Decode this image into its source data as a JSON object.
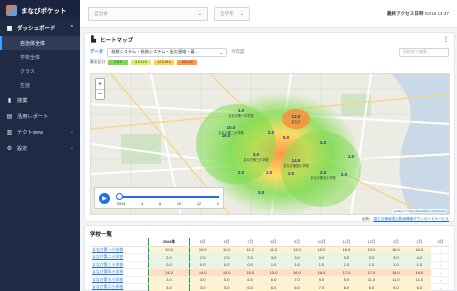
{
  "app": {
    "logo_text": "まなびポケット"
  },
  "sidebar": {
    "group_label": "ダッシュボード",
    "sub_items": [
      {
        "label": "自治体全体",
        "active": true
      },
      {
        "label": "学校全体",
        "active": false
      },
      {
        "label": "クラス",
        "active": false
      },
      {
        "label": "生徒",
        "active": false
      }
    ],
    "items": [
      {
        "label": "授業",
        "icon": "bar-chart-icon"
      },
      {
        "label": "活用レポート",
        "icon": "report-icon"
      },
      {
        "label": "テクトview",
        "icon": "analytics-icon",
        "has_children": true
      },
      {
        "label": "設定",
        "icon": "gear-icon",
        "has_children": true
      }
    ]
  },
  "topbar": {
    "select1_placeholder": "自治体",
    "select2_placeholder": "全学年",
    "last_access_label": "最終アクセス日時",
    "last_access_value": "02/16 14:47"
  },
  "heatmap": {
    "title": "ヒートマップ",
    "filter_label": "データ",
    "filter_value": "校務システム・校務システム・出欠連絡・着...",
    "sub_label": "今年度",
    "search_placeholder": "学校名で検索...",
    "legend_title": "算出区分",
    "legend": [
      {
        "label": "0-5.5",
        "color": "#7ed957"
      },
      {
        "label": "5.5-12.5",
        "color": "#d7ef6a"
      },
      {
        "label": "12.5-18.0",
        "color": "#ffd24d"
      },
      {
        "label": "18.0-22",
        "color": "#ff9a4d"
      }
    ],
    "map_labels": [
      {
        "name": "まなび第一中学校",
        "value": "1.0"
      },
      {
        "name": "まなび第二小学校",
        "value": "10.0"
      },
      {
        "name": "まなび第三小学校",
        "value": "2.0"
      },
      {
        "name": "まなび第四小学校",
        "value": "14.0"
      },
      {
        "name": "まなび第五小学校",
        "value": "3.0"
      },
      {
        "name": "まなび",
        "value": "16.0"
      },
      {
        "name": "まなび",
        "value": "13.0"
      },
      {
        "name": "まなび",
        "value": "5.0"
      }
    ],
    "timeline_ticks": [
      "2024",
      "4",
      "8",
      "10",
      "12",
      "2"
    ],
    "attribution": "Leaflet | © OpenStreetMap contributors",
    "source_label": "出典",
    "source_link": "国土交通省国土数値情報ダウンロードサービス"
  },
  "school_table": {
    "title": "学校一覧",
    "columns": [
      "",
      "2024年",
      "5月",
      "6月",
      "7月",
      "8月",
      "9月",
      "10月",
      "11月",
      "12月",
      "1月",
      "2月",
      "3月"
    ],
    "current_col": 1,
    "rows": [
      {
        "name": "まなび第一小学校",
        "values": [
          "10.0",
          "10.0",
          "11.0",
          "11.0",
          "11.0",
          "13.0",
          "15.0",
          "16.0",
          "15.0",
          "16.0",
          "16.0",
          "-"
        ],
        "level": 1
      },
      {
        "name": "まなび第二小学校",
        "values": [
          "2.0",
          "2.0",
          "2.0",
          "2.0",
          "3.0",
          "3.0",
          "3.0",
          "3.0",
          "3.0",
          "3.0",
          "4.0",
          "-"
        ],
        "level": 0
      },
      {
        "name": "まなび第三小学校",
        "values": [
          "0.0",
          "0.0",
          "0.0",
          "0.0",
          "1.0",
          "1.0",
          "1.0",
          "1.0",
          "1.0",
          "1.0",
          "1.0",
          "-"
        ],
        "level": 0
      },
      {
        "name": "まなび第四小学校",
        "values": [
          "14.0",
          "14.0",
          "15.0",
          "15.0",
          "15.0",
          "16.0",
          "16.0",
          "17.0",
          "17.0",
          "18.0",
          "19.0",
          "-"
        ],
        "level": 2
      },
      {
        "name": "まなび第五小学校",
        "values": [
          "3.0",
          "3.0",
          "5.0",
          "6.0",
          "6.0",
          "7.0",
          "9.0",
          "9.0",
          "11.0",
          "11.0",
          "11.0",
          "-"
        ],
        "level": 1
      },
      {
        "name": "まなび第六小学校",
        "values": [
          "3.0",
          "3.0",
          "5.0",
          "6.0",
          "6.0",
          "6.0",
          "7.0",
          "8.0",
          "6.0",
          "6.0",
          "6.0",
          "-"
        ],
        "level": 1
      }
    ]
  }
}
